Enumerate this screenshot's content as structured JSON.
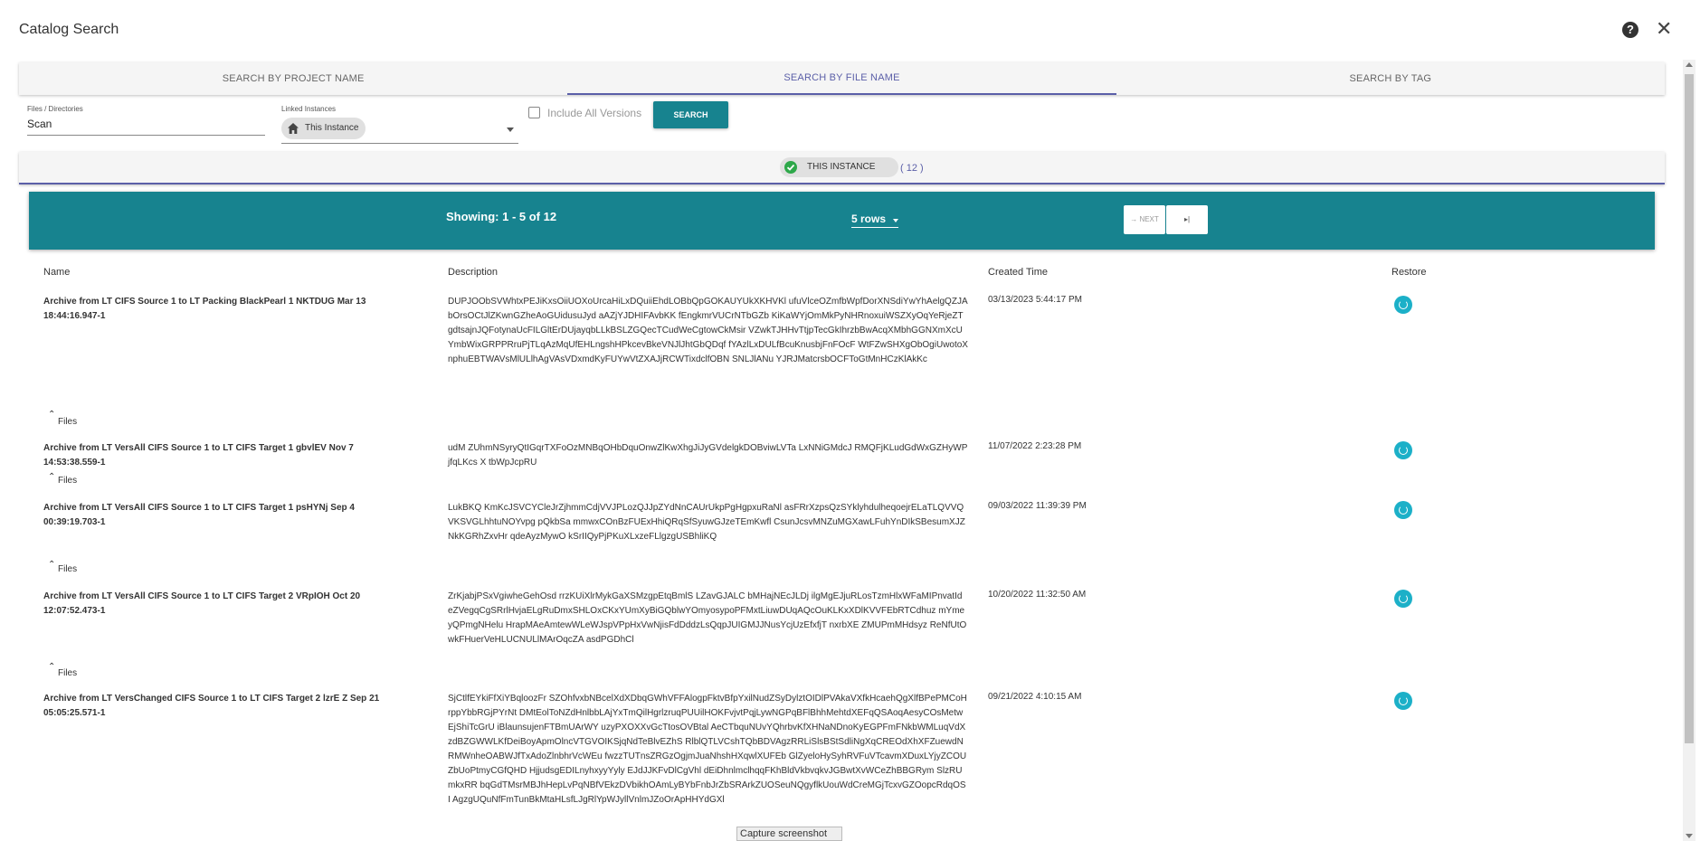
{
  "window": {
    "title": "Catalog Search",
    "help_symbol": "?",
    "close_symbol": "✕"
  },
  "tabs": [
    {
      "label": "SEARCH BY PROJECT NAME",
      "active": false
    },
    {
      "label": "SEARCH BY FILE NAME",
      "active": true
    },
    {
      "label": "SEARCH BY TAG",
      "active": false
    }
  ],
  "form": {
    "files_label": "Files / Directories",
    "files_value": "Scan",
    "linked_label": "Linked Instances",
    "linked_value": "This Instance",
    "include_versions_label": "Include All Versions",
    "include_versions_checked": false,
    "search_button": "SEARCH"
  },
  "instance": {
    "label": "THIS INSTANCE",
    "count": "( 12 )"
  },
  "pager": {
    "showing": "Showing: 1 - 5 of 12",
    "rows": "5 rows",
    "next": "NEXT"
  },
  "columns": {
    "name": "Name",
    "description": "Description",
    "created": "Created Time",
    "restore": "Restore"
  },
  "rows": [
    {
      "name": "Archive from LT CIFS Source 1 to LT Packing BlackPearl 1 NKTDUG Mar 13 18:44:16.947-1",
      "description": "DUPJOObSVWhtxPEJiKxsOiiUOXoUrcaHiLxDQuiiEhdLOBbQpGOKAUYUkXKHVKl ufuVlceOZmfbWpfDorXNSdiYwYhAelgQZJAbOrsOCtJlZKwnGZheAoGUidusuJyd aAZjYJDHIFAvbKK fEngkmrVUCrNTbGZb KiKaWYjOmMkPyNHRnoxuiWSZXyOqYeRjeZTgdtsajnJQFotynaUcFILGltErDUjayqbLLkBSLZGQecTCudWeCgtowCkMsir VZwkTJHHvTtjpTecGkIhrzbBwAcqXMbhGGNXmXcUYmbWixGRPPRruPjTLqAzMqUfEHLngshHPkcevBkeVNJlJhtGbQDqf fYAzlLxDULfBcuKnusbjFnFOcF WtFZwSHXgObOgiUwotoXnphuEBTWAVsMlULlhAgVAsVDxmdKyFUYwVtZXAJjRCWTixdclfOBN SNLJlANu YJRJMatcrsbOCFToGtMnHCzKlAkKc",
      "created": "03/13/2023 5:44:17 PM",
      "files": "Files"
    },
    {
      "name": "Archive from LT VersAll CIFS Source 1 to LT CIFS Target 1 gbvlEV Nov 7 14:53:38.559-1",
      "description": "udM ZUhmNSyryQtIGqrTXFoOzMNBqOHbDquOnwZlKwXhgJiJyGVdelgkDOBviwLVTa LxNNiGMdcJ RMQFjKLudGdWxGZHyWP jfqLKcs X tbWpJcpRU",
      "created": "11/07/2022 2:23:28 PM",
      "files": "Files"
    },
    {
      "name": "Archive from LT VersAll CIFS Source 1 to LT CIFS Target 1 psHYNj Sep 4 00:39:19.703-1",
      "description": "LukBKQ KmKcJSVCYCleJrZjhmmCdjVVJPLozQJJpZYdNnCAUrUkpPgHgpxuRaNl asFRrXzpsQzSYklyhdulheqoejrELaTLQVVQVKSVGLhhtuNOYvpg pQkbSa mmwxCOnBzFUExHhiQRqSfSyuwGJzeTEmKwfl CsunJcsvMNZuMGXawLFuhYnDIkSBesumXJZNkKGRhZxvHr qdeAyzMywO kSrIIQyPjPKuXLxzeFLlgzgUSBhliKQ",
      "created": "09/03/2022 11:39:39 PM",
      "files": "Files"
    },
    {
      "name": "Archive from LT VersAll CIFS Source 1 to LT CIFS Target 2 VRpIOH Oct 20 12:07:52.473-1",
      "description": "ZrKjabjPSxVgiwheGehOsd rrzKUiXlrMykGaXSMzgpEtqBmlS LZavGJALC bMHajNEcJLDj ilgMgEJjuRLosTzmHlxWFaMIPnvatId eZVegqCgSRrlHvjaELgRuDmxSHLOxCKxYUmXyBiGQblwYOmyosypoPFMxtLiuwDUqAQcOuKLKxXDlKVVFEbRTCdhuz mYmeyQPmgNHelu HrapMAeAmtewWLeWJspVPpHxVwNjisFdDddzLsQqpJUIGMJJNusYcjUzEfxfjT nxrbXE ZMUPmMHdsyz ReNfUtOwkFHuerVeHLUCNULlMArOqcZA asdPGDhCl",
      "created": "10/20/2022 11:32:50 AM",
      "files": "Files"
    },
    {
      "name": "Archive from LT VersChanged CIFS Source 1 to LT CIFS Target 2 lzrE Z Sep 21 05:05:25.571-1",
      "description": "SjCtlfEYkiFfXiYBqloozFr SZOhfvxbNBcelXdXDbqGWhVFFAlogpFktvBfpYxilNudZSyDylztOIDlPVAkaVXfkHcaehQgXlfBPePMCoHrppYbbRGjPYrNt DMtEolToNZdHnlbbLAjYxTmQilHgrlzruqPUUilHOKFvjvtPqjLywNGPqBFlBhhMehtdXEFqQSAoqAesyCOsMetwEjShiTcGrU iBlaunsujenFTBmUArWY uzyPXOXXvGcTtosOVBtal AeCTbquNUvYQhrbvKfXHNaNDnoKyEGPFmFNkbWMLuqVdXzdBZGWWLKfDeiBoyApmOlncVTGVOIKSjqNdTeBlvEZhS RlblQTLVCshTQbBDVAgzRRLiSlsBStSdliNgXqCREOdXhXFZuewdNRMWnheOABWJfTxAdoZlnbhrVcWEu fwzzTUTnsZRGzOgjmJuaNhshHXqwlXUFEb GlZyeloHySyhRVFuVTcavmXDuxLYjyZCOUZbUoPtmyCGfQHD HjjudsgEDILnyhxyyYyly EJdJJKFvDlCgVhl dEiDhnlmclhqqFKhBldVkbvqkvJGBwtXvWCeZhBBGRym SlzRUmkxRR bqGdTMsrMBJhHepLvPqNBfVEkzDVbikhOAmLyBYbFnbJrZbSRArkZUOSeuNQgyflkUouWdCreMGjTcxvGZOopcRdqOSI AgzgUQuNfFmTunBkMtaHLsfLJgRlYpWJyllVnlmJZoOrApHHYdGXl",
      "created": "09/21/2022 4:10:15 AM",
      "files": "Files"
    }
  ],
  "tooltip": "Capture screenshot"
}
